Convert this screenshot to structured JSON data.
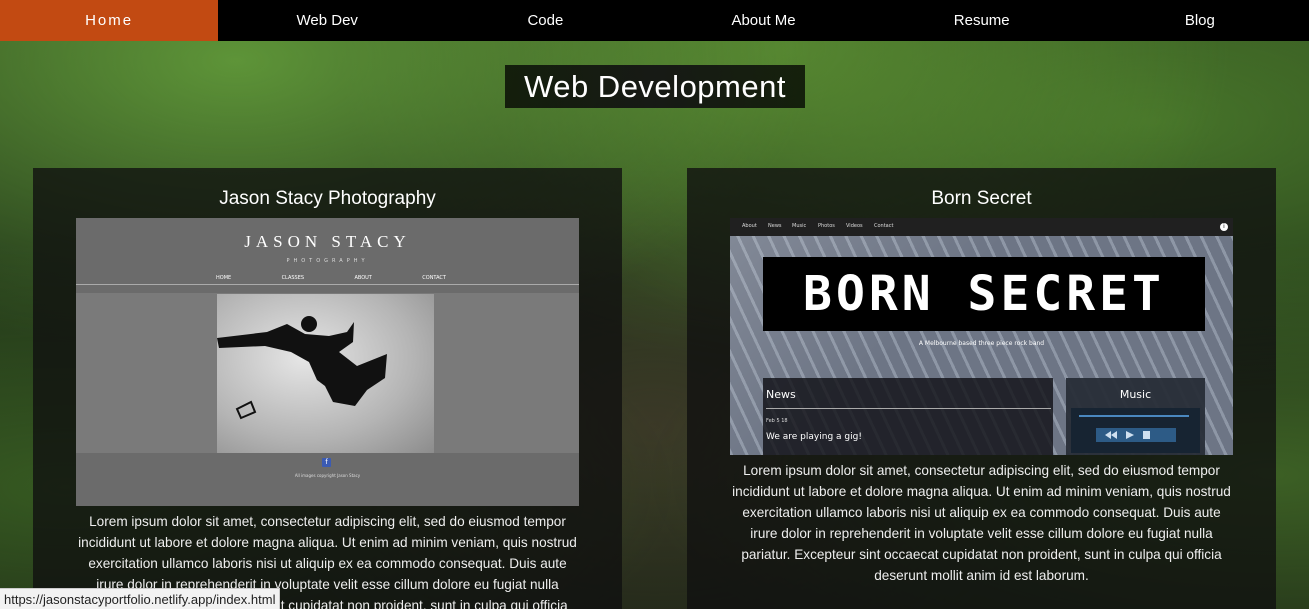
{
  "nav": {
    "items": [
      {
        "label": "Home",
        "active": true
      },
      {
        "label": "Web Dev",
        "active": false
      },
      {
        "label": "Code",
        "active": false
      },
      {
        "label": "About Me",
        "active": false
      },
      {
        "label": "Resume",
        "active": false
      },
      {
        "label": "Blog",
        "active": false
      }
    ]
  },
  "page": {
    "title": "Web Development"
  },
  "projects": [
    {
      "title": "Jason Stacy Photography",
      "preview": {
        "brand": "JASON STACY",
        "subtitle": "PHOTOGRAPHY",
        "menu": [
          "HOME",
          "CLASSES",
          "ABOUT",
          "CONTACT"
        ],
        "footer": "All images copyright Jason Stacy"
      },
      "description": "Lorem ipsum dolor sit amet, consectetur adipiscing elit, sed do eiusmod tempor incididunt ut labore et dolore magna aliqua. Ut enim ad minim veniam, quis nostrud exercitation ullamco laboris nisi ut aliquip ex ea commodo consequat. Duis aute irure dolor in reprehenderit in voluptate velit esse cillum dolore eu fugiat nulla pariatur. Excepteur sint occaecat cupidatat non proident, sunt in culpa qui officia deserunt mollit anim id est laborum."
    },
    {
      "title": "Born Secret",
      "preview": {
        "menu": [
          "About",
          "News",
          "Music",
          "Photos",
          "Videos",
          "Contact"
        ],
        "logo": "BORN SECRET",
        "tagline": "A Melbourne based three piece rock band",
        "news_heading": "News",
        "news_date": "Feb 5 18",
        "news_item": "We are playing a gig!",
        "music_heading": "Music"
      },
      "description": "Lorem ipsum dolor sit amet, consectetur adipiscing elit, sed do eiusmod tempor incididunt ut labore et dolore magna aliqua. Ut enim ad minim veniam, quis nostrud exercitation ullamco laboris nisi ut aliquip ex ea commodo consequat. Duis aute irure dolor in reprehenderit in voluptate velit esse cillum dolore eu fugiat nulla pariatur. Excepteur sint occaecat cupidatat non proident, sunt in culpa qui officia deserunt mollit anim id est laborum."
    }
  ],
  "status_bar": {
    "url": "https://jasonstacyportfolio.netlify.app/index.html"
  },
  "colors": {
    "nav_active": "#c24a12",
    "nav_bg": "#000000"
  }
}
